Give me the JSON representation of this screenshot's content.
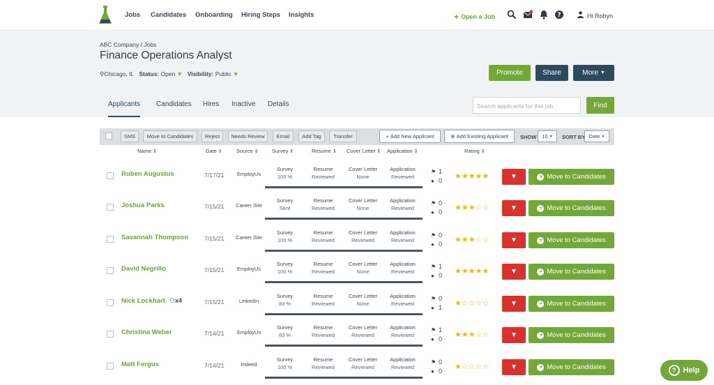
{
  "nav": {
    "links": [
      "Jobs",
      "Candidates",
      "Onboarding",
      "Hiring Steps",
      "Insights"
    ],
    "open_job": "Open a Job",
    "greeting": "Hi Robyn"
  },
  "header": {
    "breadcrumb": "ABC Company / Jobs",
    "title": "Finance Operations Analyst",
    "location": "Chicago, IL",
    "status_label": "Status:",
    "status_value": "Open",
    "visibility_label": "Visibility:",
    "visibility_value": "Public",
    "promote": "Promote",
    "share": "Share",
    "more": "More"
  },
  "tabs": [
    "Applicants",
    "Candidates",
    "Hires",
    "Inactive",
    "Details"
  ],
  "search": {
    "placeholder": "Search applicants for this job",
    "button": "Find"
  },
  "toolbar": {
    "buttons": [
      "SMS",
      "Move to Candidates",
      "Reject",
      "Needs Review",
      "Email",
      "Add Tag",
      "Transfer"
    ],
    "add_new": "Add New Applicant",
    "add_existing": "Add Existing Applicant",
    "show_label": "SHOW",
    "show_value": "10",
    "sort_label": "SORT BY",
    "sort_value": "Date"
  },
  "columns": [
    "Name",
    "Date",
    "Source",
    "Survey",
    "Resume",
    "Cover Letter",
    "Application",
    "Rating"
  ],
  "applicants": [
    {
      "name": "Ruben Augustus",
      "extra": "",
      "date": "7/17/21",
      "source": "EmployUs",
      "survey": "100 %",
      "resume": "Reviewed",
      "cover": "None",
      "application": "Reviewed",
      "tags": "1",
      "comments": "0",
      "rating": 5
    },
    {
      "name": "Joshua Parks",
      "extra": "",
      "date": "7/15/21",
      "source": "Career Site",
      "survey": "Sent",
      "resume": "Reviewed",
      "cover": "None",
      "application": "Reviewed",
      "tags": "0",
      "comments": "0",
      "rating": 3
    },
    {
      "name": "Savannah Thompson",
      "extra": "",
      "date": "7/15/21",
      "source": "Career Site",
      "survey": "100 %",
      "resume": "Reviewed",
      "cover": "Reviewed",
      "application": "Reviewed",
      "tags": "0",
      "comments": "0",
      "rating": 3
    },
    {
      "name": "David Negrillo",
      "extra": "",
      "date": "7/15/21",
      "source": "EmployUs",
      "survey": "100 %",
      "resume": "Reviewed",
      "cover": "None",
      "application": "Reviewed",
      "tags": "1",
      "comments": "0",
      "rating": 5
    },
    {
      "name": "Nick Lockhart",
      "extra": "x4",
      "date": "7/15/21",
      "source": "LinkedIn",
      "survey": "83 %",
      "resume": "Reviewed",
      "cover": "None",
      "application": "Reviewed",
      "tags": "0",
      "comments": "1",
      "rating": 1
    },
    {
      "name": "Christina Weber",
      "extra": "",
      "date": "7/14/21",
      "source": "EmployUs",
      "survey": "83 %",
      "resume": "Reviewed",
      "cover": "Reviewed",
      "application": "Reviewed",
      "tags": "1",
      "comments": "0",
      "rating": 3
    },
    {
      "name": "Matt Fergus",
      "extra": "",
      "date": "7/14/21",
      "source": "Indeed",
      "survey": "100 %",
      "resume": "Reviewed",
      "cover": "Reviewed",
      "application": "Reviewed",
      "tags": "0",
      "comments": "0",
      "rating": 1
    }
  ],
  "row_labels": {
    "survey": "Survey",
    "resume": "Resume",
    "cover": "Cover Letter",
    "application": "Application",
    "move": "Move to Candidates"
  },
  "help": "Help",
  "colors": {
    "accent_green": "#72a83a",
    "navy": "#2c4a5e",
    "reject_red": "#d9322e",
    "star": "#f3b700"
  }
}
